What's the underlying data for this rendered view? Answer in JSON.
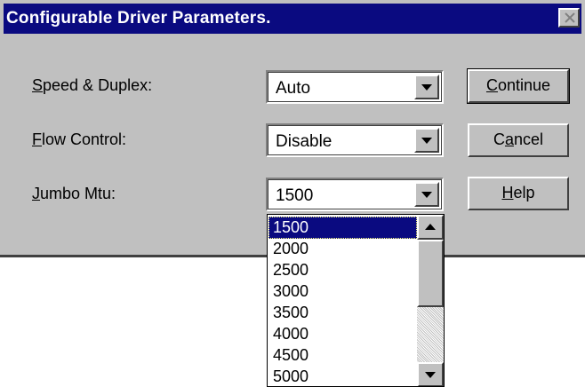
{
  "dialog": {
    "title": "Configurable Driver Parameters.",
    "close_icon": "close-icon"
  },
  "fields": {
    "speed_duplex": {
      "label_accel": "S",
      "label_rest": "peed & Duplex:",
      "value": "Auto"
    },
    "flow_control": {
      "label_accel": "F",
      "label_rest": "low Control:",
      "value": "Disable"
    },
    "jumbo_mtu": {
      "label_accel": "J",
      "label_rest": "umbo Mtu:",
      "value": "1500"
    }
  },
  "buttons": {
    "continue": {
      "accel": "C",
      "rest": "ontinue"
    },
    "cancel": {
      "pre": "C",
      "accel": "a",
      "rest": "ncel"
    },
    "help": {
      "accel": "H",
      "rest": "elp"
    }
  },
  "dropdown": {
    "options": [
      "1500",
      "2000",
      "2500",
      "3000",
      "3500",
      "4000",
      "4500",
      "5000"
    ],
    "selected_index": 0
  },
  "colors": {
    "titlebar": "#0a0a80",
    "face": "#c0c0c0",
    "selection": "#0a0a80"
  }
}
